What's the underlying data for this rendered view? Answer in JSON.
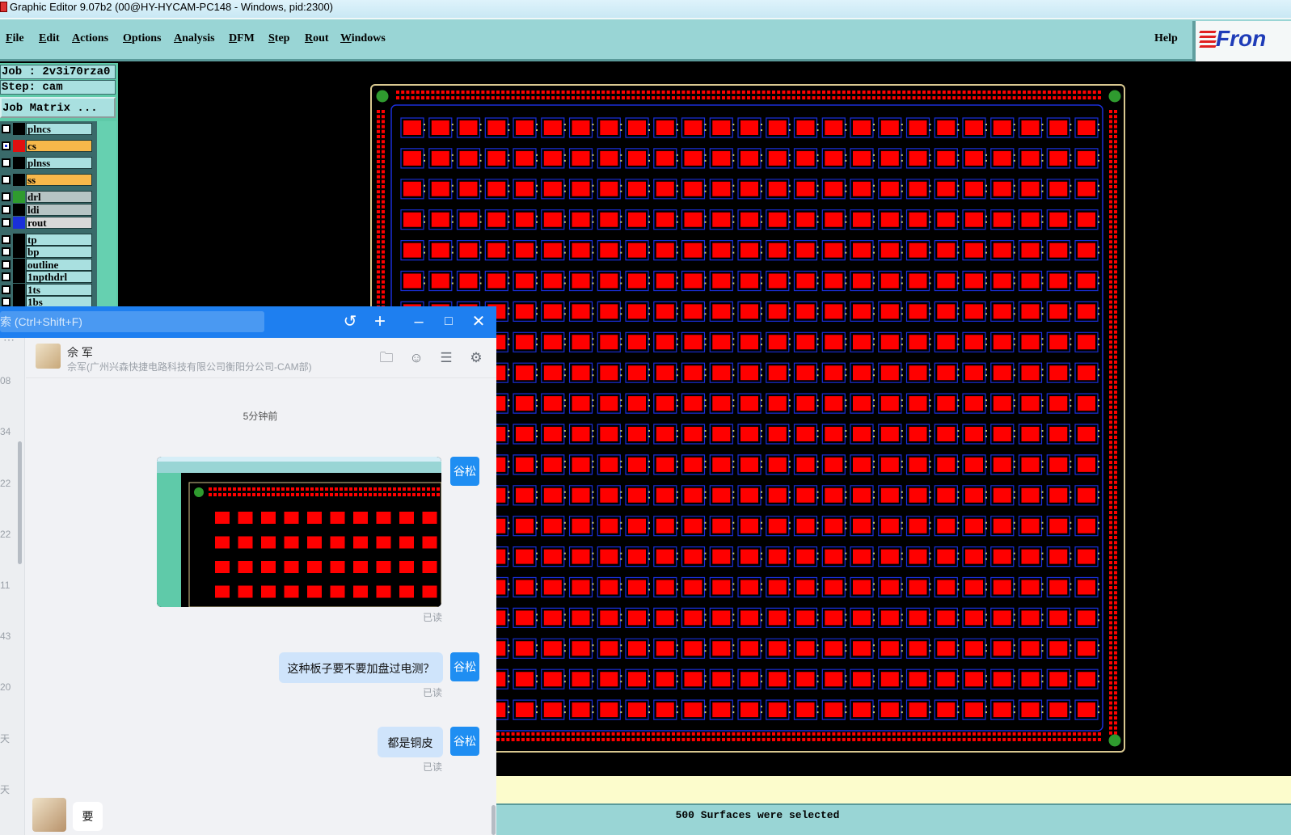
{
  "window": {
    "title": "Graphic Editor 9.07b2 (00@HY-HYCAM-PC148 - Windows, pid:2300)"
  },
  "menu": {
    "items": [
      {
        "label": "File",
        "u": "F",
        "rest": "ile"
      },
      {
        "label": "Edit",
        "u": "E",
        "rest": "dit"
      },
      {
        "label": "Actions",
        "u": "A",
        "rest": "ctions"
      },
      {
        "label": "Options",
        "u": "O",
        "rest": "ptions"
      },
      {
        "label": "Analysis",
        "u": "A",
        "rest": "nalysis"
      },
      {
        "label": "DFM",
        "u": "D",
        "rest": "FM"
      },
      {
        "label": "Step",
        "u": "S",
        "rest": "tep"
      },
      {
        "label": "Rout",
        "u": "R",
        "rest": "out"
      },
      {
        "label": "Windows",
        "u": "W",
        "rest": "indows"
      }
    ],
    "help": "Help",
    "brand": "Fron"
  },
  "panel": {
    "job": "Job : 2v3i70rza0",
    "step": "Step: cam",
    "job_matrix": "Job Matrix ..."
  },
  "layers": [
    {
      "name": "plncs",
      "color": "#000000",
      "bg": "#a9e0e0",
      "checked": false
    },
    {
      "name": "cs",
      "color": "#e01010",
      "bg": "#f7b84a",
      "checked": true
    },
    {
      "name": "plnss",
      "color": "#000000",
      "bg": "#a9e0e0",
      "checked": false
    },
    {
      "name": "ss",
      "color": "#000000",
      "bg": "#f7b84a",
      "checked": false
    },
    {
      "name": "drl",
      "color": "#2f9b2f",
      "bg": "#b6c4c4",
      "checked": false
    },
    {
      "name": "ldi",
      "color": "#000000",
      "bg": "#b6c4c4",
      "checked": false
    },
    {
      "name": "rout",
      "color": "#1a2fd8",
      "bg": "#d8d8d8",
      "checked": false
    },
    {
      "name": "tp",
      "color": "#000000",
      "bg": "#a9e0e0",
      "checked": false
    },
    {
      "name": "bp",
      "color": "#000000",
      "bg": "#a9e0e0",
      "checked": false
    },
    {
      "name": "outline",
      "color": "#000000",
      "bg": "#a9e0e0",
      "checked": false
    },
    {
      "name": "1npthdrl",
      "color": "#000000",
      "bg": "#a9e0e0",
      "checked": false
    },
    {
      "name": "1ts",
      "color": "#000000",
      "bg": "#a9e0e0",
      "checked": false
    },
    {
      "name": "1bs",
      "color": "#000000",
      "bg": "#a9e0e0",
      "checked": false
    }
  ],
  "status": {
    "message": "500 Surfaces were selected"
  },
  "chat": {
    "search_placeholder": "索 (Ctrl+Shift+F)",
    "side_numbers": [
      "08",
      "34",
      "22",
      "22",
      "11",
      "43",
      "20",
      "天",
      "天"
    ],
    "contact_name": "佘 军",
    "contact_sub": "佘军(广州兴森快捷电路科技有限公司衡阳分公司-CAM部)",
    "time": "5分钟前",
    "sender_name": "谷松",
    "messages": [
      {
        "text": "这种板子要不要加盘过电测？",
        "read": "已读"
      },
      {
        "text": "都是铜皮",
        "read": "已读"
      }
    ],
    "image_read": "已读",
    "incoming": "要"
  },
  "colors": {
    "pad": "#ff0000",
    "trace": "#1a2fd8",
    "fiducial": "#2f9b2f",
    "menu_bg": "#99d5d5",
    "chat_accent": "#1e7ff0"
  }
}
